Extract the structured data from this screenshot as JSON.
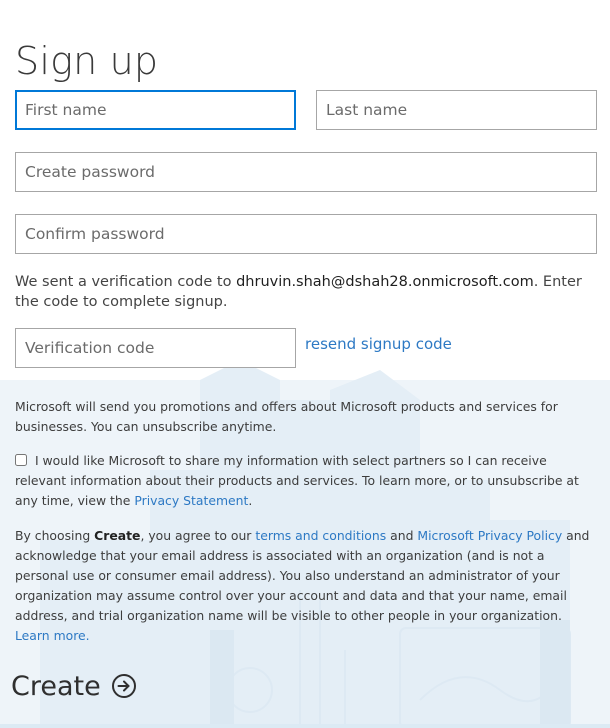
{
  "page": {
    "title": "Sign up"
  },
  "form": {
    "first_name_placeholder": "First name",
    "last_name_placeholder": "Last name",
    "create_password_placeholder": "Create password",
    "confirm_password_placeholder": "Confirm password",
    "verification_code_placeholder": "Verification code"
  },
  "verification": {
    "text_before": "We sent a verification code to ",
    "email": "dhruvin.shah@dshah28.onmicrosoft.com",
    "text_after": ". Enter the code to complete signup.",
    "resend_label": "resend signup code"
  },
  "promotions": {
    "text": "Microsoft will send you promotions and offers about Microsoft products and services for businesses. You can unsubscribe anytime."
  },
  "partners": {
    "checkbox_checked": false,
    "text": " I would like Microsoft to share my information with select partners so I can receive relevant information about their products and services. To learn more, or to unsubscribe at any time, view the ",
    "privacy_link": "Privacy Statement",
    "text_end": "."
  },
  "terms": {
    "t1": "By choosing ",
    "create_word": "Create",
    "t2": ", you agree to our ",
    "terms_link": "terms and conditions",
    "t3": " and ",
    "privacy_policy_link": "Microsoft Privacy Policy",
    "t4": " and acknowledge that your email address is associated with an organization (and is not a personal use or consumer email address). You also understand an administrator of your organization may assume control over your account and data and that your name, email address, and trial organization name will be visible to other people in your organization. ",
    "learn_more_link": "Learn more."
  },
  "actions": {
    "create_label": "Create"
  },
  "colors": {
    "accent": "#0078d7",
    "link": "#2d79c4",
    "background_art": "#edf4f9"
  },
  "icons": {
    "create": "circle-arrow-right-icon"
  }
}
